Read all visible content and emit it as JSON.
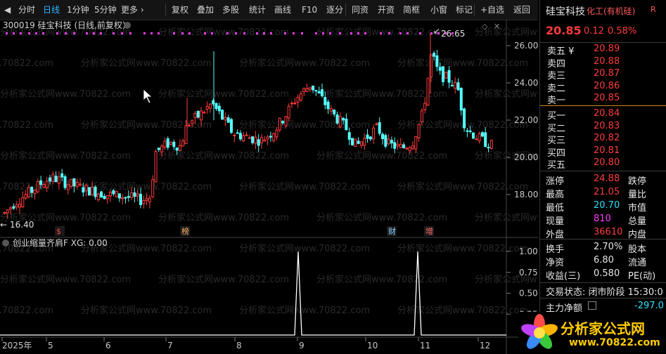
{
  "toolbar": {
    "items": [
      "分时",
      "日线",
      "1分钟",
      "5分钟",
      "更多 ›",
      "复权",
      "叠加",
      "多股",
      "统计",
      "画线",
      "F10",
      "逐分",
      "同资",
      "开资",
      "简框",
      "小窗",
      "标记",
      "+自选",
      "返回"
    ],
    "active_index": 1
  },
  "chart": {
    "stock_title": "300019 硅宝科技 (日线,前复权)",
    "title_dropdown_icon": "chevron-down-icon",
    "y_ticks": [
      "26.00",
      "24.00",
      "22.00",
      "20.00",
      "18.00"
    ],
    "high_label": "26.65",
    "low_label": "16.40",
    "markers": [
      {
        "text": "$",
        "color": "#ff3c3c"
      },
      {
        "text": "榜",
        "color": "#ffb060"
      },
      {
        "text": "财",
        "color": "#8ad4ff"
      },
      {
        "text": "增",
        "color": "#ff6a6a"
      }
    ],
    "x_labels": [
      "2025年",
      "5",
      "6",
      "7",
      "8",
      "9",
      "10",
      "11",
      "12"
    ],
    "watermark": "分析家公式网www.70822.com",
    "up_color": "#ff3c3c",
    "down_color": "#54ffff"
  },
  "indicator": {
    "title": "创业缩量齐肩F  XG: 0.00",
    "y_ticks": [
      "1.00",
      "0.75",
      "0.50",
      "0.25"
    ],
    "line_color": "#ffffff"
  },
  "quote": {
    "name": "硅宝科技",
    "sector": "化工(有机硅)",
    "r_badge": "R",
    "price": "20.85",
    "change": "0.12",
    "change_pct": "0.58%",
    "asks": [
      {
        "label": "卖五 ¥",
        "price": "20.89"
      },
      {
        "label": "卖四",
        "price": "20.88"
      },
      {
        "label": "卖三",
        "price": "20.87"
      },
      {
        "label": "卖二",
        "price": "20.86"
      },
      {
        "label": "卖一",
        "price": "20.85"
      }
    ],
    "bids": [
      {
        "label": "买一",
        "price": "20.84"
      },
      {
        "label": "买二",
        "price": "20.83"
      },
      {
        "label": "买三",
        "price": "20.82"
      },
      {
        "label": "买四",
        "price": "20.81"
      },
      {
        "label": "买五",
        "price": "20.80"
      }
    ],
    "stats": [
      {
        "l": "涨停",
        "v": "24.88",
        "vc": "red",
        "r": "跌停"
      },
      {
        "l": "最高",
        "v": "21.05",
        "vc": "red",
        "r": "量比"
      },
      {
        "l": "最低",
        "v": "20.70",
        "vc": "cyan",
        "r": "市值"
      },
      {
        "l": "现量",
        "v": "810",
        "vc": "mag",
        "r": "总量"
      },
      {
        "l": "外盘",
        "v": "36610",
        "vc": "red",
        "r": "内盘"
      }
    ],
    "stats2": [
      {
        "l": "换手",
        "v": "2.70%",
        "r": "股本"
      },
      {
        "l": "净资",
        "v": "6.80",
        "r": "流通"
      },
      {
        "l": "收益(三)",
        "v": "0.580",
        "r": "PE(动)"
      }
    ],
    "trade_status": "交易状态: 闭市阶段  15:30:0",
    "main_flow_label": "主力净额",
    "main_flow_value": "-297.0"
  },
  "logo": {
    "text": "分析家公式网",
    "url": "www.70822.com"
  }
}
